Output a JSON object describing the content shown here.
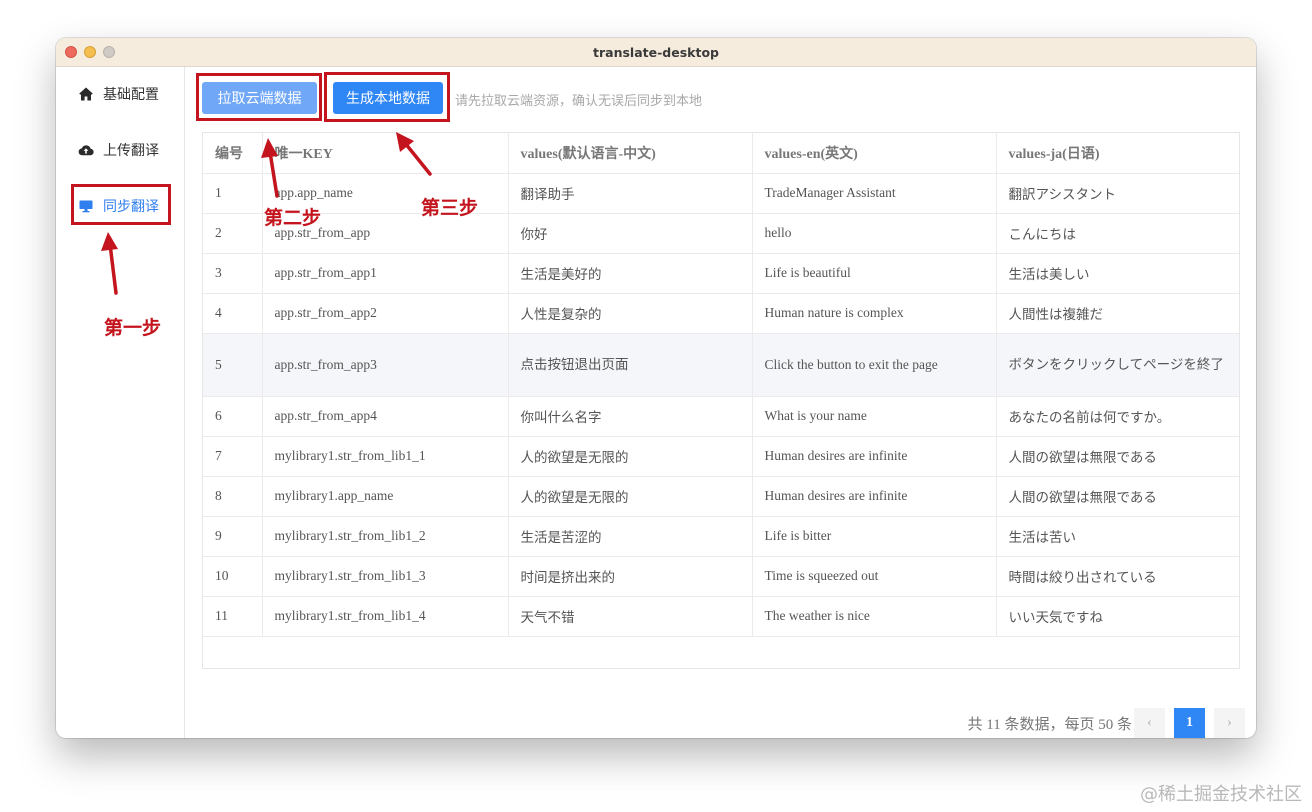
{
  "window": {
    "title": "translate-desktop"
  },
  "sidebar": {
    "items": [
      {
        "label": "基础配置",
        "icon": "home-icon",
        "active": false
      },
      {
        "label": "上传翻译",
        "icon": "cloud-upload-icon",
        "active": false
      },
      {
        "label": "同步翻译",
        "icon": "monitor-icon",
        "active": true
      }
    ]
  },
  "toolbar": {
    "pull_label": "拉取云端数据",
    "generate_label": "生成本地数据",
    "hint": "请先拉取云端资源，确认无误后同步到本地"
  },
  "table": {
    "headers": [
      "编号",
      "唯一KEY",
      "values(默认语言-中文)",
      "values-en(英文)",
      "values-ja(日语)"
    ],
    "rows": [
      [
        "1",
        "app.app_name",
        "翻译助手",
        "TradeManager Assistant",
        "翻訳アシスタント"
      ],
      [
        "2",
        "app.str_from_app",
        "你好",
        "hello",
        "こんにちは"
      ],
      [
        "3",
        "app.str_from_app1",
        "生活是美好的",
        "Life is beautiful",
        "生活は美しい"
      ],
      [
        "4",
        "app.str_from_app2",
        "人性是复杂的",
        "Human nature is complex",
        "人間性は複雑だ"
      ],
      [
        "5",
        "app.str_from_app3",
        "点击按钮退出页面",
        "Click the button to exit the page",
        "ボタンをクリックしてページを終了"
      ],
      [
        "6",
        "app.str_from_app4",
        "你叫什么名字",
        "What is your name",
        "あなたの名前は何ですか。"
      ],
      [
        "7",
        "mylibrary1.str_from_lib1_1",
        "人的欲望是无限的",
        "Human desires are infinite",
        "人間の欲望は無限である"
      ],
      [
        "8",
        "mylibrary1.app_name",
        "人的欲望是无限的",
        "Human desires are infinite",
        "人間の欲望は無限である"
      ],
      [
        "9",
        "mylibrary1.str_from_lib1_2",
        "生活是苦涩的",
        "Life is bitter",
        "生活は苦い"
      ],
      [
        "10",
        "mylibrary1.str_from_lib1_3",
        "时间是挤出来的",
        "Time is squeezed out",
        "時間は絞り出されている"
      ],
      [
        "11",
        "mylibrary1.str_from_lib1_4",
        "天气不错",
        "The weather is nice",
        "いい天気ですね"
      ]
    ]
  },
  "pagination": {
    "total_text": "共 11 条数据，每页 50 条",
    "current_page": "1",
    "prev": "‹",
    "next": "›"
  },
  "annotations": {
    "step1": "第一步",
    "step2": "第二步",
    "step3": "第三步"
  },
  "watermark": "@稀土掘金技术社区",
  "colors": {
    "accent": "#2f86f5",
    "pull_button": "#70a8f7",
    "annotation_red": "#c4141d",
    "active_nav": "#2f7fef"
  }
}
